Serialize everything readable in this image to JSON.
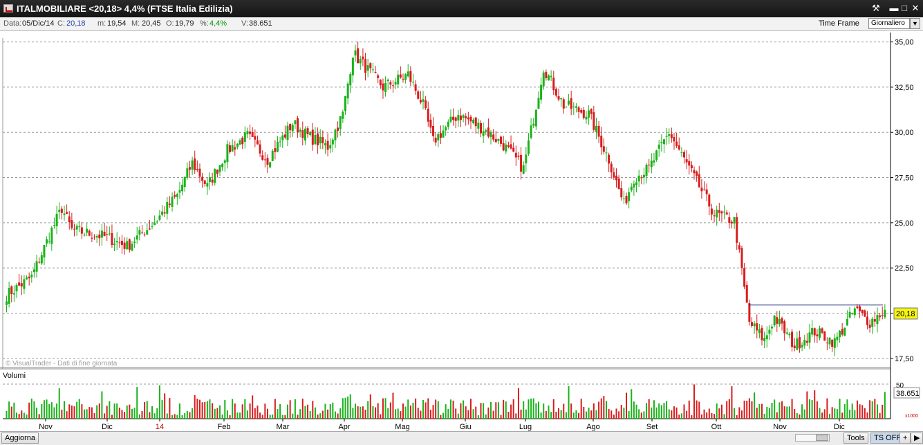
{
  "window": {
    "title": "ITALMOBILIARE <20,18> 4,4%  (FTSE Italia Edilizia)",
    "tools_icon": "wrench-icon",
    "minimize_icon": "minimize-icon",
    "maximize_icon": "maximize-icon",
    "close_icon": "close-icon"
  },
  "infobar": {
    "date_label": "Data:",
    "date_value": "05/Dic/14",
    "close_label": "C:",
    "close_value": "20,18",
    "min_label": "m:",
    "min_value": "19,54",
    "max_label": "M:",
    "max_value": "20,45",
    "open_label": "O:",
    "open_value": "19,79",
    "pct_label": "%:",
    "pct_value": "4,4%",
    "vol_label": "V:",
    "vol_value": "38.651",
    "timeframe_label": "Time Frame",
    "timeframe_value": "Giornaliero"
  },
  "chart": {
    "watermark": "© VisualTrader - Dati di fine giornata",
    "volume_label": "Volumi",
    "last_price_label": "20,18",
    "last_volume_label": "38.651",
    "volume_scale_unit": "x1000",
    "volume_axis_label": "50",
    "colors": {
      "up": "#19b319",
      "down": "#d91c1c",
      "resistance": "#1f2a80",
      "price_tag": "#f5f511"
    }
  },
  "chart_data": {
    "type": "candlestick",
    "y_ticks": [
      "35,00",
      "32,50",
      "30,00",
      "27,50",
      "25,00",
      "22,50",
      "20,00",
      "17,50"
    ],
    "y_range": [
      17.3,
      35.1
    ],
    "x_labels": [
      "Nov",
      "Dic",
      "14",
      "Feb",
      "Mar",
      "Apr",
      "Mag",
      "Giu",
      "Lug",
      "Ago",
      "Set",
      "Ott",
      "Nov",
      "Dic"
    ],
    "anchors": [
      [
        0,
        21.0
      ],
      [
        10,
        22.0
      ],
      [
        18,
        24.6
      ],
      [
        22,
        25.8
      ],
      [
        26,
        24.6
      ],
      [
        40,
        24.2
      ],
      [
        48,
        23.7
      ],
      [
        58,
        24.9
      ],
      [
        68,
        26.5
      ],
      [
        74,
        28.3
      ],
      [
        80,
        27.0
      ],
      [
        88,
        29.0
      ],
      [
        96,
        29.8
      ],
      [
        104,
        28.5
      ],
      [
        114,
        30.5
      ],
      [
        120,
        29.8
      ],
      [
        128,
        29.2
      ],
      [
        134,
        31.0
      ],
      [
        138,
        34.4
      ],
      [
        150,
        32.5
      ],
      [
        160,
        33.2
      ],
      [
        166,
        31.5
      ],
      [
        170,
        29.5
      ],
      [
        180,
        31.0
      ],
      [
        190,
        30.2
      ],
      [
        198,
        29.3
      ],
      [
        206,
        28.0
      ],
      [
        214,
        33.6
      ],
      [
        222,
        31.5
      ],
      [
        232,
        31.0
      ],
      [
        240,
        28.5
      ],
      [
        246,
        26.0
      ],
      [
        250,
        27.5
      ],
      [
        256,
        28.0
      ],
      [
        264,
        30.0
      ],
      [
        270,
        28.5
      ],
      [
        276,
        27.0
      ],
      [
        282,
        25.5
      ],
      [
        290,
        25.1
      ],
      [
        296,
        19.5
      ],
      [
        302,
        18.5
      ],
      [
        306,
        19.8
      ],
      [
        314,
        18.2
      ],
      [
        322,
        19.0
      ],
      [
        330,
        18.4
      ],
      [
        338,
        20.2
      ],
      [
        344,
        19.5
      ],
      [
        350,
        20.18
      ]
    ],
    "resistance_level": 20.45,
    "last_close": 20.18,
    "last_volume_thousands": 38.651
  }
}
